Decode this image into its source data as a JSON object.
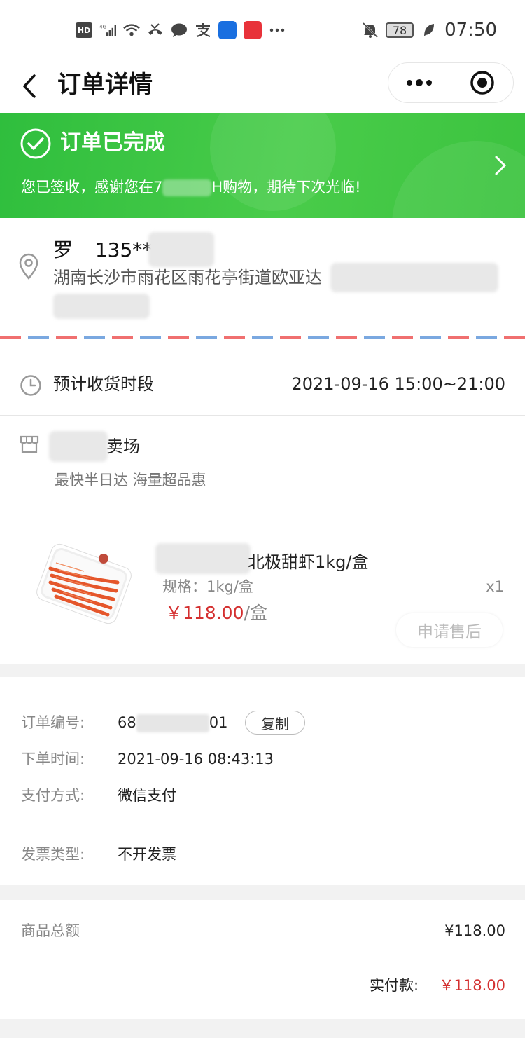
{
  "status_bar": {
    "hd": "HD",
    "network": "4G",
    "battery": "78",
    "time": "07:50"
  },
  "nav": {
    "title": "订单详情"
  },
  "banner": {
    "title": "订单已完成",
    "subtitle_prefix": "您已签收，感谢您在7",
    "subtitle_suffix": "H购物，期待下次光临!",
    "color": "#3cc33f"
  },
  "address": {
    "name": "罗",
    "phone": "135***",
    "line": "湖南长沙市雨花区雨花亭街道欧亚达"
  },
  "delivery": {
    "label": "预计收货时段",
    "value": "2021-09-16 15:00~21:00"
  },
  "store": {
    "name_suffix": "卖场",
    "tagline": "最快半日达 海量超品惠"
  },
  "product": {
    "name": "北极甜虾1kg/盒",
    "spec": "规格：1kg/盒",
    "quantity": "x1",
    "price": "￥118.00",
    "unit": "/盒",
    "after_sale_label": "申请售后"
  },
  "order_info": {
    "order_no_label": "订单编号:",
    "order_no_prefix": "68",
    "order_no_suffix": "01",
    "copy_label": "复制",
    "order_time_label": "下单时间:",
    "order_time": "2021-09-16 08:43:13",
    "payment_label": "支付方式:",
    "payment": "微信支付",
    "invoice_label": "发票类型:",
    "invoice": "不开发票"
  },
  "totals": {
    "goods_total_label": "商品总额",
    "goods_total": "¥118.00",
    "paid_label": "实付款:",
    "paid": "￥118.00",
    "price_color": "#d42f2f"
  }
}
